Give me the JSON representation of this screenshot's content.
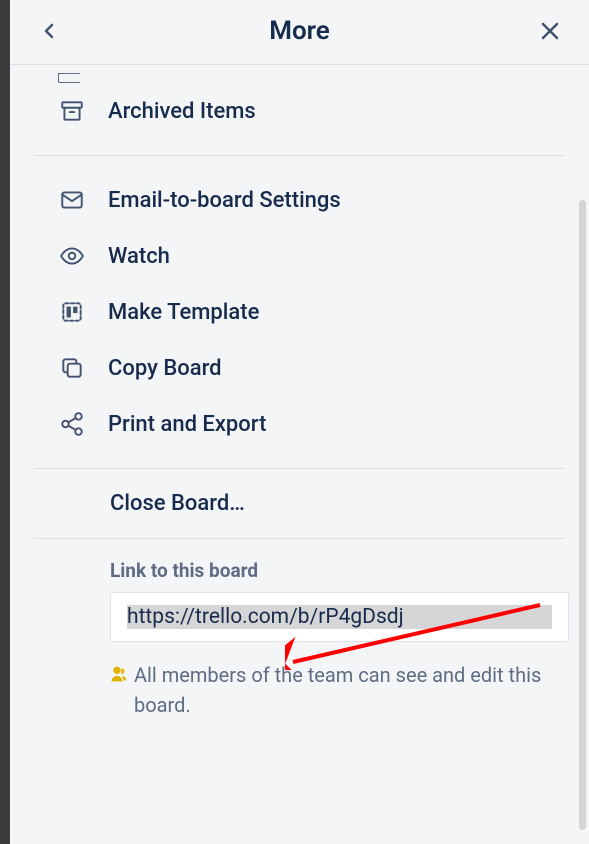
{
  "header": {
    "title": "More"
  },
  "menu": {
    "archived": "Archived Items",
    "email": "Email-to-board Settings",
    "watch": "Watch",
    "makeTemplate": "Make Template",
    "copyBoard": "Copy Board",
    "printExport": "Print and Export",
    "closeBoard": "Close Board…"
  },
  "link": {
    "label": "Link to this board",
    "url": "https://trello.com/b/rP4gDsdj",
    "visibilityText": "All members of the team can see and edit this board."
  },
  "colors": {
    "text": "#172b4d",
    "muted": "#5e6c84",
    "accentRed": "#ff0000",
    "visibilityIcon": "#e2b203"
  }
}
